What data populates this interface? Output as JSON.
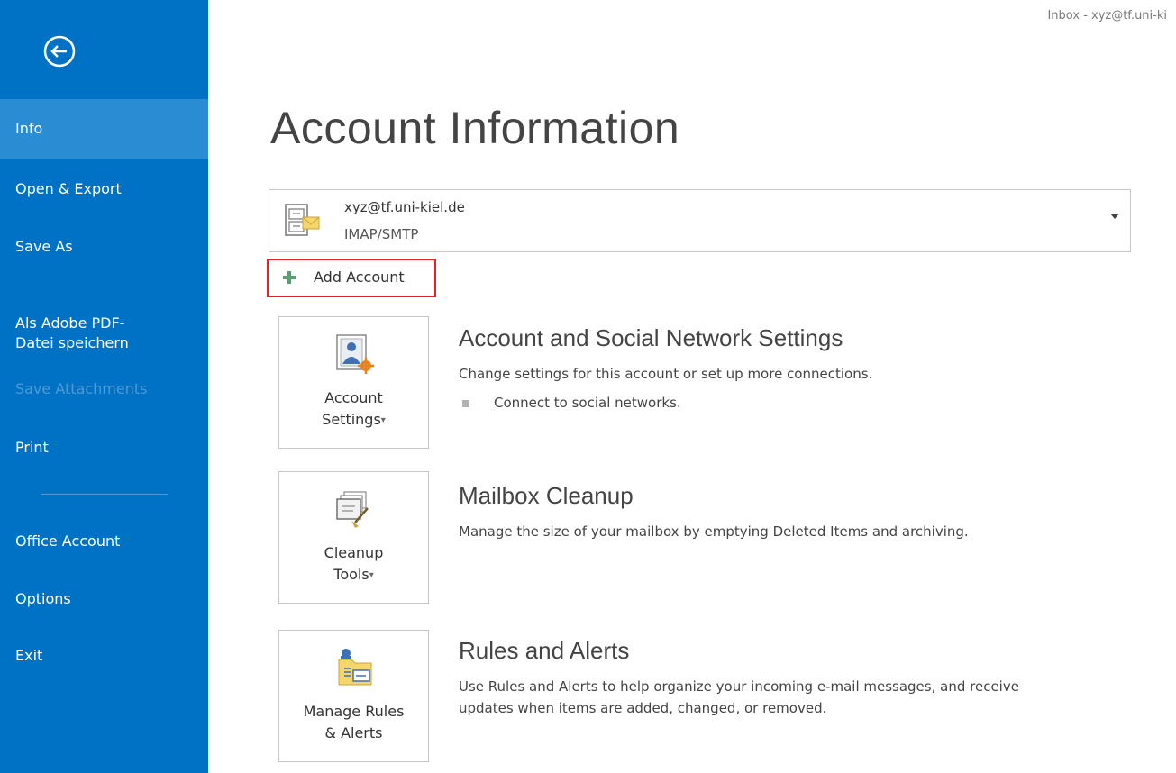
{
  "window": {
    "title": "Inbox - xyz@tf.uni-ki"
  },
  "sidebar": {
    "back_icon": "back-arrow-circle-icon",
    "items": [
      {
        "label": "Info",
        "active": true
      },
      {
        "label": "Open & Export"
      },
      {
        "label": "Save As"
      },
      {
        "label": "Als Adobe PDF-\nDatei speichern"
      },
      {
        "label": "Save Attachments",
        "disabled": true
      },
      {
        "label": "Print"
      },
      {
        "label": "Office Account"
      },
      {
        "label": "Options"
      },
      {
        "label": "Exit"
      }
    ]
  },
  "main": {
    "title": "Account Information",
    "account": {
      "email": "xyz@tf.uni-kiel.de",
      "type": "IMAP/SMTP"
    },
    "add_account": {
      "label": "Add Account",
      "highlight_color": "#e8202a"
    },
    "sections": [
      {
        "tile_label_line1": "Account",
        "tile_label_line2": "Settings",
        "title": "Account and Social Network Settings",
        "description": "Change settings for this account or set up more connections.",
        "bullet": "Connect to social networks."
      },
      {
        "tile_label_line1": "Cleanup",
        "tile_label_line2": "Tools",
        "title": "Mailbox Cleanup",
        "description": "Manage the size of your mailbox by emptying Deleted Items and archiving."
      },
      {
        "tile_label_line1": "Manage Rules",
        "tile_label_line2": "& Alerts",
        "title": "Rules and Alerts",
        "description_line1": "Use Rules and Alerts to help organize your incoming e-mail messages, and receive",
        "description_line2": "updates when items are added, changed, or removed."
      }
    ]
  },
  "colors": {
    "sidebar_bg": "#0072c6",
    "sidebar_active": "#2a8dd4",
    "highlight_border": "#e8202a"
  }
}
